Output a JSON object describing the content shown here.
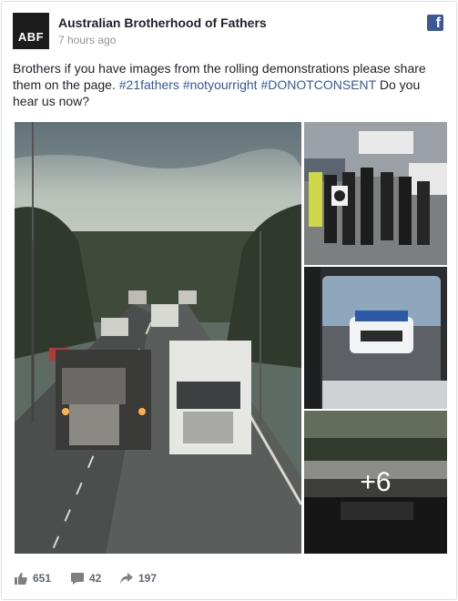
{
  "post": {
    "page_name": "Australian Brotherhood of Fathers",
    "avatar_text": "ABF",
    "timestamp": "7 hours ago",
    "text_prefix": "Brothers if you have images from the rolling demonstrations please share them on the page.",
    "hashtags": [
      "#21fathers",
      "#notyourright",
      "#DONOTCONSENT"
    ],
    "text_suffix": "Do you hear us now?",
    "more_photos": "+6"
  },
  "stats": {
    "likes": "651",
    "comments": "42",
    "shares": "197"
  },
  "icons": [
    "facebook-logo-icon",
    "like-icon",
    "comment-icon",
    "share-icon"
  ],
  "colors": {
    "link": "#365899",
    "facebook": "#3b5998",
    "meta": "#90949c"
  }
}
